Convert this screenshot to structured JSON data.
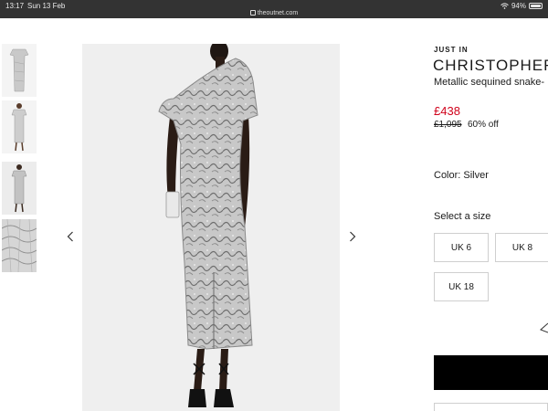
{
  "status_bar": {
    "time": "13:17",
    "date": "Sun 13 Feb",
    "url": "theoutnet.com",
    "battery": "94%",
    "battery_level": 0.94
  },
  "gallery": {
    "thumbnails": [
      {
        "name": "front-full-length"
      },
      {
        "name": "front-on-model"
      },
      {
        "name": "back-on-model"
      },
      {
        "name": "fabric-detail"
      }
    ],
    "prev_icon": "chevron-left-icon",
    "next_icon": "chevron-right-icon"
  },
  "product": {
    "badge": "JUST IN",
    "brand": "CHRISTOPHER",
    "title": "Metallic sequined snake-",
    "price": "£438",
    "original_price": "£1,095",
    "discount": "60% off",
    "color_label": "Color: Silver",
    "size_label": "Select a size",
    "sizes": [
      "UK 6",
      "UK 8",
      "UK 18"
    ]
  },
  "colors": {
    "sale_red": "#d0021b",
    "status_bar": "#333333"
  }
}
